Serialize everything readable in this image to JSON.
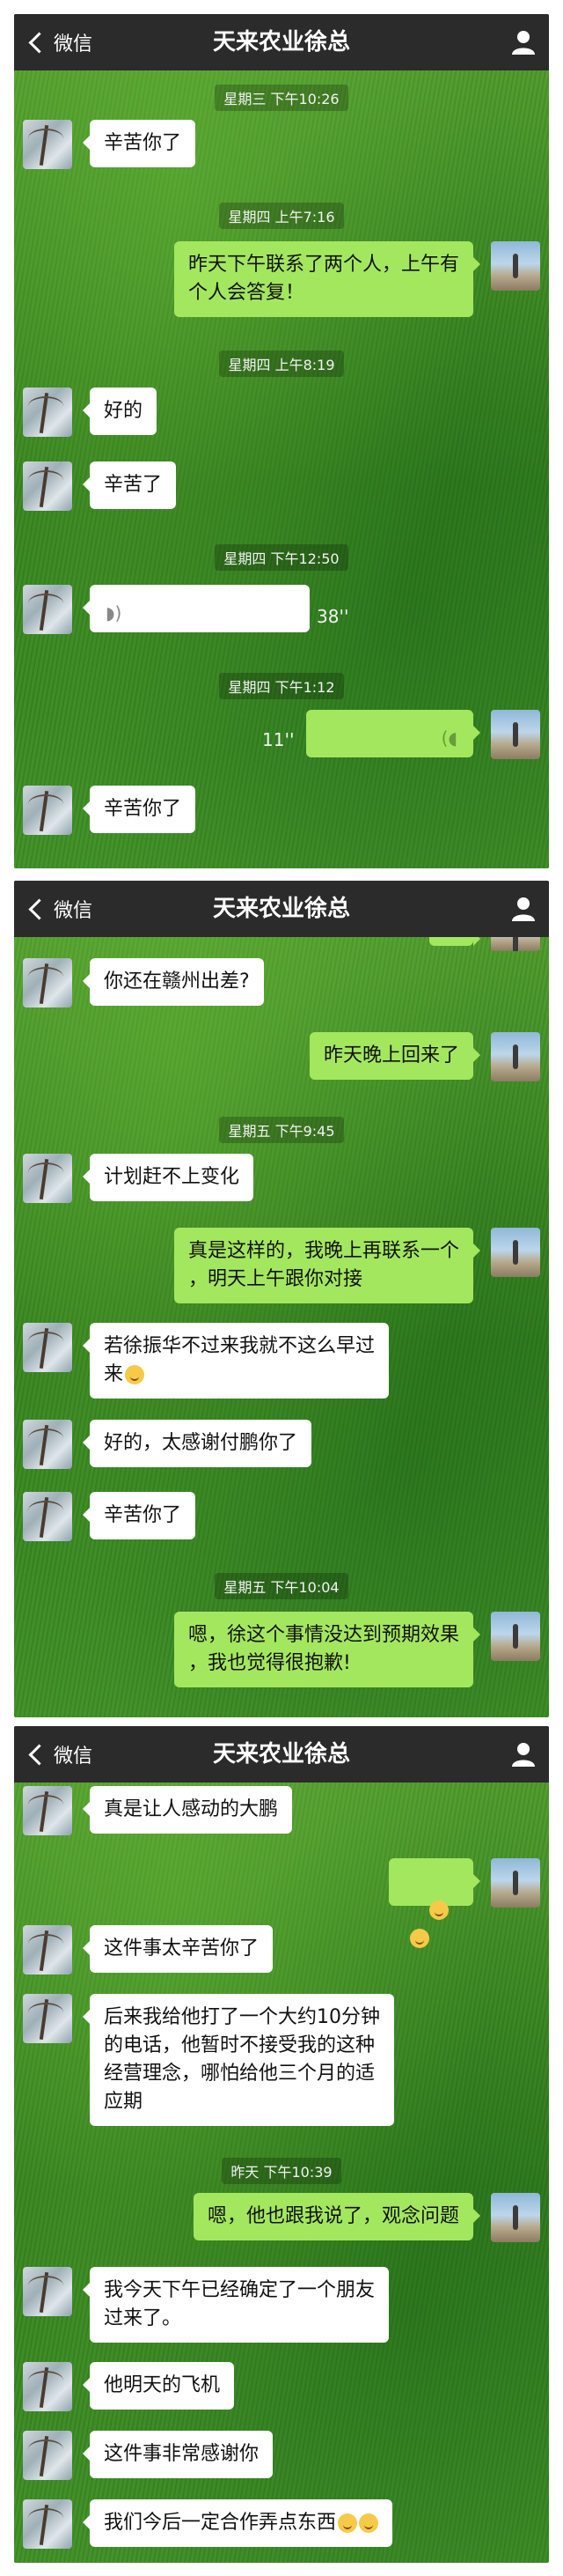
{
  "header": {
    "back_label": "微信",
    "title": "天来农业徐总",
    "profile_icon": "person-icon"
  },
  "panel1": {
    "ts1": "星期三 下午10:26",
    "msg1": "辛苦你了",
    "ts2": "星期四 上午7:16",
    "msg2": "昨天下午联系了两个人，上午有\n个人会答复！",
    "ts3": "星期四 上午8:19",
    "msg3": "好的",
    "msg4": "辛苦了",
    "ts4": "星期四 下午12:50",
    "voice_in_duration": "38''",
    "ts5": "星期四 下午1:12",
    "voice_out_duration": "11''",
    "msg5": "辛苦你了"
  },
  "panel2": {
    "msg1": "你还在赣州出差?",
    "msg2": "昨天晚上回来了",
    "ts1": "星期五 下午9:45",
    "msg3": "计划赶不上变化",
    "msg4": "真是这样的，我晚上再联系一个\n，明天上午跟你对接",
    "msg5": "若徐振华不过来我就不这么早过\n来",
    "msg6": "好的，太感谢付鹏你了",
    "msg7": "辛苦你了",
    "ts2": "星期五 下午10:04",
    "msg8": "嗯，徐这个事情没达到预期效果\n，我也觉得很抱歉!"
  },
  "panel3": {
    "msg1": "真是让人感动的大鹏",
    "msg3": "这件事太辛苦你了",
    "msg4": "后来我给他打了一个大约10分钟\n的电话，他暂时不接受我的这种\n经营理念，哪怕给他三个月的适\n应期",
    "ts1": "昨天 下午10:39",
    "msg5": "嗯，他也跟我说了，观念问题",
    "msg6": "我今天下午已经确定了一个朋友\n过来了。",
    "msg7": "他明天的飞机",
    "msg8": "这件事非常感谢你",
    "msg9": "我们今后一定合作弄点东西"
  }
}
